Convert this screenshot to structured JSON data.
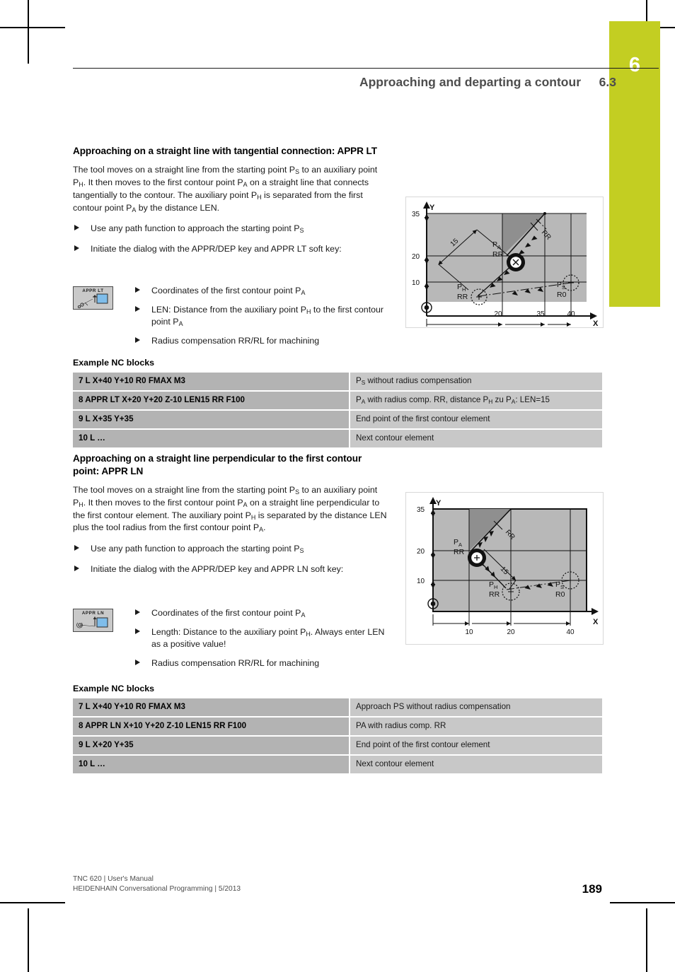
{
  "page": {
    "chapter_number": "6",
    "tab_color": "#c3ce22",
    "header_title": "Approaching and departing a contour",
    "header_section": "6.3",
    "page_number": "189"
  },
  "sections": [
    {
      "heading": "Approaching on a straight line with tangential connection: APPR LT",
      "paragraph_html": "The tool moves on a straight line from the starting point P<sub>S</sub> to an auxiliary point P<sub>H</sub>. It then moves to the first contour point P<sub>A</sub> on a straight line that connects tangentially to the contour. The auxiliary point P<sub>H</sub> is separated from the first contour point P<sub>A</sub> by the distance LEN.",
      "bullets": [
        "Use any path function to approach the starting point P<sub>S</sub>",
        "Initiate the dialog with the APPR/DEP key and APPR LT soft key:"
      ],
      "softkey_label": "APPR LT",
      "softkey_icon": "appr-lt-softkey-icon",
      "sub_bullets": [
        "Coordinates of the first contour point P<sub>A</sub>",
        "LEN: Distance from the auxiliary point P<sub>H</sub> to the first contour point P<sub>A</sub>",
        "Radius compensation RR/RL for machining"
      ],
      "table_title": "Example NC blocks",
      "table_rows": [
        {
          "code": "7 L X+40 Y+10 R0 FMAX M3",
          "desc_html": "P<sub>S</sub> without radius compensation"
        },
        {
          "code": "8 APPR LT X+20 Y+20 Z-10 LEN15 RR F100",
          "desc_html": "P<sub>A</sub> with radius comp. RR, distance P<sub>H</sub> zu P<sub>A</sub>: LEN=15"
        },
        {
          "code": "9 L X+35 Y+35",
          "desc_html": "End point of the first contour element"
        },
        {
          "code": "10 L …",
          "desc_html": "Next contour element"
        }
      ],
      "figure": {
        "name": "appr-lt-diagram",
        "axis_x_label": "X",
        "axis_y_label": "Y",
        "y_ticks": [
          "35",
          "20",
          "10"
        ],
        "x_ticks": [
          "20",
          "35",
          "40"
        ],
        "dimension_label": "15",
        "point_labels": [
          {
            "name": "P",
            "sub": "A",
            "comp": "RR"
          },
          {
            "name": "P",
            "sub": "H",
            "comp": "RR"
          },
          {
            "name": "P",
            "sub": "S",
            "comp": "R0"
          }
        ],
        "compensation_label": "RR"
      }
    },
    {
      "heading": "Approaching on a straight line perpendicular to the first contour point: APPR LN",
      "paragraph_html": "The tool moves on a straight line from the starting point P<sub>S</sub> to an auxiliary point P<sub>H</sub>. It then moves to the first contour point P<sub>A</sub> on a straight line perpendicular to the first contour element. The auxiliary point P<sub>H</sub> is separated by the distance LEN plus the tool radius from the first contour point P<sub>A</sub>.",
      "bullets": [
        "Use any path function to approach the starting point P<sub>S</sub>",
        "Initiate the dialog with the APPR/DEP key and APPR LN soft key:"
      ],
      "softkey_label": "APPR LN",
      "softkey_icon": "appr-ln-softkey-icon",
      "sub_bullets": [
        "Coordinates of the first contour point P<sub>A</sub>",
        "Length: Distance to the auxiliary point P<sub>H</sub>. Always enter LEN as a positive value!",
        "Radius compensation RR/RL for machining"
      ],
      "table_title": "Example NC blocks",
      "table_rows": [
        {
          "code": "7 L X+40 Y+10 R0 FMAX M3",
          "desc_html": "Approach PS without radius compensation"
        },
        {
          "code": "8 APPR LN X+10 Y+20 Z-10 LEN15 RR F100",
          "desc_html": "PA with radius comp. RR"
        },
        {
          "code": "9 L X+20 Y+35",
          "desc_html": "End point of the first contour element"
        },
        {
          "code": "10 L …",
          "desc_html": "Next contour element"
        }
      ],
      "figure": {
        "name": "appr-ln-diagram",
        "axis_x_label": "X",
        "axis_y_label": "Y",
        "y_ticks": [
          "35",
          "20",
          "10"
        ],
        "x_ticks": [
          "10",
          "20",
          "40"
        ],
        "dimension_label": "15",
        "point_labels": [
          {
            "name": "P",
            "sub": "A",
            "comp": "RR"
          },
          {
            "name": "P",
            "sub": "H",
            "comp": "RR"
          },
          {
            "name": "P",
            "sub": "S",
            "comp": "R0"
          }
        ],
        "compensation_label": "RR"
      }
    }
  ],
  "footer": {
    "line1": "TNC 620 | User's Manual",
    "line2": "HEIDENHAIN Conversational Programming | 5/2013"
  },
  "colors": {
    "tab": "#c3ce22",
    "table_code_bg": "#b3b3b3",
    "table_desc_bg": "#c8c8c8",
    "figure_bg": "#b8b8b8",
    "figure_dark": "#8f8f8f",
    "header_text": "#4d4d4d"
  }
}
